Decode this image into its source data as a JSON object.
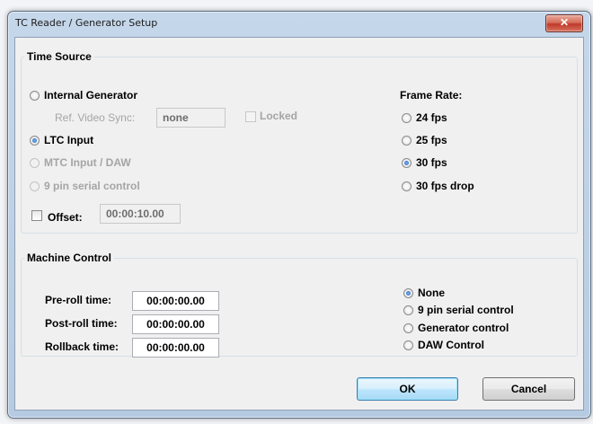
{
  "window": {
    "title": "TC Reader / Generator Setup",
    "close_glyph": "✕"
  },
  "time_source": {
    "title": "Time Source",
    "options": [
      {
        "label": "Internal Generator",
        "selected": false,
        "enabled": true
      },
      {
        "label": "LTC Input",
        "selected": true,
        "enabled": true
      },
      {
        "label": "MTC Input / DAW",
        "selected": false,
        "enabled": false
      },
      {
        "label": "9 pin serial control",
        "selected": false,
        "enabled": false
      }
    ],
    "ref_video_sync": {
      "label": "Ref. Video Sync:",
      "value": "none",
      "enabled": false
    },
    "locked": {
      "label": "Locked",
      "checked": false,
      "enabled": false
    },
    "offset": {
      "label": "Offset:",
      "checked": false,
      "value": "00:00:10.00",
      "enabled": false
    }
  },
  "frame_rate": {
    "title": "Frame Rate:",
    "options": [
      {
        "label": "24 fps",
        "selected": false
      },
      {
        "label": "25 fps",
        "selected": false
      },
      {
        "label": "30 fps",
        "selected": true
      },
      {
        "label": "30 fps drop",
        "selected": false
      }
    ]
  },
  "machine_control": {
    "title": "Machine Control",
    "fields": [
      {
        "label": "Pre-roll time:",
        "value": "00:00:00.00"
      },
      {
        "label": "Post-roll time:",
        "value": "00:00:00.00"
      },
      {
        "label": "Rollback time:",
        "value": "00:00:00.00"
      }
    ],
    "options": [
      {
        "label": "None",
        "selected": true
      },
      {
        "label": "9 pin serial control",
        "selected": false
      },
      {
        "label": "Generator control",
        "selected": false
      },
      {
        "label": "DAW Control",
        "selected": false
      }
    ]
  },
  "buttons": {
    "ok": "OK",
    "cancel": "Cancel"
  },
  "colors": {
    "selected_radio": "#1c5fb5",
    "disabled_text": "#a5a5a5",
    "close_button": "#c0392b",
    "default_button_border": "#3c7fb1"
  }
}
